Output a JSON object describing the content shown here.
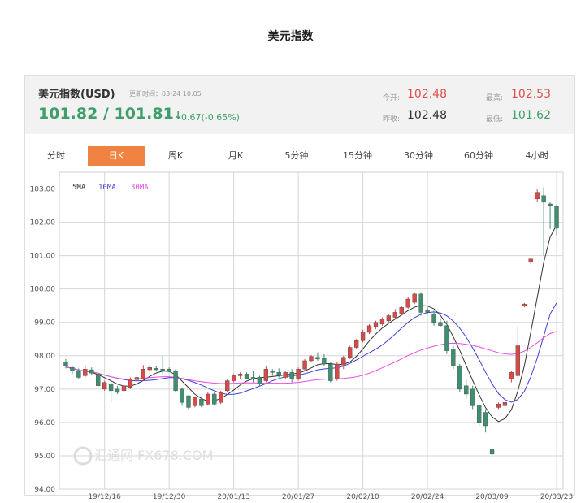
{
  "page_title": "美元指数",
  "quote": {
    "name": "美元指数(USD)",
    "update_time": "更新时间：03-24 10:05",
    "price": "101.82 / 101.81",
    "arrow": "↓",
    "change": "-0.67(-0.65%)",
    "open_label": "今开:",
    "open_value": "102.48",
    "high_label": "最高:",
    "high_value": "102.53",
    "prev_close_label": "昨收:",
    "prev_close_value": "102.48",
    "low_label": "最低:",
    "low_value": "101.62"
  },
  "tabs": [
    {
      "label": "分时",
      "active": false
    },
    {
      "label": "日K",
      "active": true
    },
    {
      "label": "周K",
      "active": false
    },
    {
      "label": "月K",
      "active": false
    },
    {
      "label": "5分钟",
      "active": false
    },
    {
      "label": "15分钟",
      "active": false
    },
    {
      "label": "30分钟",
      "active": false
    },
    {
      "label": "60分钟",
      "active": false
    },
    {
      "label": "4小时",
      "active": false
    }
  ],
  "watermark": "汇通网 FX678.COM",
  "colors": {
    "up": "#d64a4a",
    "down": "#3f8f6e",
    "price_green": "#3f9f6a",
    "accent_red": "#e0524c",
    "tab_active": "#f08341",
    "ma5": "#333333",
    "ma10": "#3f40d6",
    "ma30": "#e64fe3"
  },
  "chart_data": {
    "type": "candlestick",
    "title": "",
    "xlabel": "",
    "ylabel": "",
    "ylim": [
      94.0,
      103.5
    ],
    "yticks": [
      "94.00",
      "95.00",
      "96.00",
      "97.00",
      "98.00",
      "99.00",
      "100.00",
      "101.00",
      "102.00",
      "103.00"
    ],
    "xtick_labels": [
      "19/12/16",
      "19/12/30",
      "20/01/13",
      "20/01/27",
      "20/02/10",
      "20/02/24",
      "20/03/09",
      "20/03/23"
    ],
    "grid": true,
    "legend": [
      "5MA",
      "10MA",
      "30MA"
    ],
    "legend_position": "top-left",
    "candles": [
      {
        "o": 97.82,
        "h": 97.9,
        "l": 97.62,
        "c": 97.7
      },
      {
        "o": 97.65,
        "h": 97.7,
        "l": 97.45,
        "c": 97.55
      },
      {
        "o": 97.55,
        "h": 97.62,
        "l": 97.3,
        "c": 97.35
      },
      {
        "o": 97.4,
        "h": 97.7,
        "l": 97.35,
        "c": 97.6
      },
      {
        "o": 97.58,
        "h": 97.65,
        "l": 97.42,
        "c": 97.48
      },
      {
        "o": 97.45,
        "h": 97.5,
        "l": 97.05,
        "c": 97.1
      },
      {
        "o": 97.0,
        "h": 97.25,
        "l": 96.95,
        "c": 97.2
      },
      {
        "o": 97.15,
        "h": 97.25,
        "l": 96.6,
        "c": 96.95
      },
      {
        "o": 97.0,
        "h": 97.1,
        "l": 96.85,
        "c": 96.9
      },
      {
        "o": 96.95,
        "h": 97.15,
        "l": 96.9,
        "c": 97.1
      },
      {
        "o": 97.05,
        "h": 97.35,
        "l": 97.0,
        "c": 97.3
      },
      {
        "o": 97.28,
        "h": 97.42,
        "l": 97.2,
        "c": 97.35
      },
      {
        "o": 97.3,
        "h": 97.72,
        "l": 97.25,
        "c": 97.6
      },
      {
        "o": 97.58,
        "h": 97.75,
        "l": 97.5,
        "c": 97.65
      },
      {
        "o": 97.62,
        "h": 97.7,
        "l": 97.55,
        "c": 97.58
      },
      {
        "o": 97.6,
        "h": 98.0,
        "l": 97.45,
        "c": 97.55
      },
      {
        "o": 97.6,
        "h": 97.65,
        "l": 97.5,
        "c": 97.55
      },
      {
        "o": 97.55,
        "h": 97.6,
        "l": 96.9,
        "c": 96.95
      },
      {
        "o": 97.0,
        "h": 97.05,
        "l": 96.5,
        "c": 96.6
      },
      {
        "o": 96.8,
        "h": 96.82,
        "l": 96.4,
        "c": 96.45
      },
      {
        "o": 96.5,
        "h": 96.78,
        "l": 96.45,
        "c": 96.75
      },
      {
        "o": 96.7,
        "h": 96.75,
        "l": 96.45,
        "c": 96.5
      },
      {
        "o": 96.55,
        "h": 96.9,
        "l": 96.5,
        "c": 96.85
      },
      {
        "o": 96.85,
        "h": 96.9,
        "l": 96.5,
        "c": 96.55
      },
      {
        "o": 96.6,
        "h": 96.95,
        "l": 96.55,
        "c": 96.9
      },
      {
        "o": 96.95,
        "h": 97.3,
        "l": 96.9,
        "c": 97.25
      },
      {
        "o": 97.25,
        "h": 97.45,
        "l": 97.2,
        "c": 97.4
      },
      {
        "o": 97.4,
        "h": 97.5,
        "l": 97.3,
        "c": 97.45
      },
      {
        "o": 97.45,
        "h": 97.5,
        "l": 97.3,
        "c": 97.32
      },
      {
        "o": 97.35,
        "h": 97.55,
        "l": 97.2,
        "c": 97.3
      },
      {
        "o": 97.35,
        "h": 97.4,
        "l": 97.1,
        "c": 97.15
      },
      {
        "o": 97.25,
        "h": 97.7,
        "l": 97.2,
        "c": 97.6
      },
      {
        "o": 97.55,
        "h": 97.6,
        "l": 97.4,
        "c": 97.5
      },
      {
        "o": 97.5,
        "h": 97.62,
        "l": 97.35,
        "c": 97.4
      },
      {
        "o": 97.35,
        "h": 97.55,
        "l": 97.3,
        "c": 97.5
      },
      {
        "o": 97.5,
        "h": 97.6,
        "l": 97.2,
        "c": 97.3
      },
      {
        "o": 97.3,
        "h": 97.65,
        "l": 97.25,
        "c": 97.6
      },
      {
        "o": 97.6,
        "h": 97.9,
        "l": 97.55,
        "c": 97.85
      },
      {
        "o": 97.85,
        "h": 98.02,
        "l": 97.8,
        "c": 97.98
      },
      {
        "o": 97.95,
        "h": 98.1,
        "l": 97.85,
        "c": 97.9
      },
      {
        "o": 97.92,
        "h": 98.05,
        "l": 97.7,
        "c": 97.75
      },
      {
        "o": 97.75,
        "h": 97.8,
        "l": 97.2,
        "c": 97.25
      },
      {
        "o": 97.3,
        "h": 97.82,
        "l": 97.25,
        "c": 97.75
      },
      {
        "o": 97.72,
        "h": 98.0,
        "l": 97.6,
        "c": 97.95
      },
      {
        "o": 97.95,
        "h": 98.3,
        "l": 97.9,
        "c": 98.25
      },
      {
        "o": 98.25,
        "h": 98.5,
        "l": 98.2,
        "c": 98.45
      },
      {
        "o": 98.45,
        "h": 98.78,
        "l": 98.4,
        "c": 98.72
      },
      {
        "o": 98.7,
        "h": 98.95,
        "l": 98.65,
        "c": 98.9
      },
      {
        "o": 98.88,
        "h": 99.05,
        "l": 98.8,
        "c": 99.0
      },
      {
        "o": 98.95,
        "h": 99.15,
        "l": 98.9,
        "c": 99.1
      },
      {
        "o": 99.05,
        "h": 99.25,
        "l": 99.0,
        "c": 99.2
      },
      {
        "o": 99.15,
        "h": 99.4,
        "l": 99.1,
        "c": 99.3
      },
      {
        "o": 99.25,
        "h": 99.5,
        "l": 99.2,
        "c": 99.45
      },
      {
        "o": 99.45,
        "h": 99.75,
        "l": 99.4,
        "c": 99.7
      },
      {
        "o": 99.6,
        "h": 99.9,
        "l": 99.55,
        "c": 99.85
      },
      {
        "o": 99.85,
        "h": 99.9,
        "l": 99.2,
        "c": 99.3
      },
      {
        "o": 99.35,
        "h": 99.45,
        "l": 99.25,
        "c": 99.3
      },
      {
        "o": 99.25,
        "h": 99.35,
        "l": 98.9,
        "c": 99.0
      },
      {
        "o": 99.0,
        "h": 99.1,
        "l": 98.85,
        "c": 98.9
      },
      {
        "o": 98.9,
        "h": 99.05,
        "l": 98.05,
        "c": 98.15
      },
      {
        "o": 98.2,
        "h": 98.3,
        "l": 97.6,
        "c": 97.7
      },
      {
        "o": 97.7,
        "h": 97.75,
        "l": 96.9,
        "c": 97.0
      },
      {
        "o": 97.1,
        "h": 97.3,
        "l": 96.7,
        "c": 96.85
      },
      {
        "o": 97.0,
        "h": 97.1,
        "l": 96.4,
        "c": 96.5
      },
      {
        "o": 96.5,
        "h": 96.6,
        "l": 95.9,
        "c": 96.0
      },
      {
        "o": 96.3,
        "h": 96.4,
        "l": 95.7,
        "c": 95.9
      },
      {
        "o": 95.2,
        "h": 95.25,
        "l": 95.0,
        "c": 95.05
      },
      {
        "o": 96.45,
        "h": 96.6,
        "l": 96.4,
        "c": 96.55
      },
      {
        "o": 96.5,
        "h": 96.65,
        "l": 96.45,
        "c": 96.6
      },
      {
        "o": 97.3,
        "h": 97.55,
        "l": 97.2,
        "c": 97.5
      },
      {
        "o": 97.4,
        "h": 98.85,
        "l": 97.3,
        "c": 98.3
      },
      {
        "o": 99.5,
        "h": 99.58,
        "l": 99.45,
        "c": 99.55
      },
      {
        "o": 100.8,
        "h": 100.95,
        "l": 100.75,
        "c": 100.9
      },
      {
        "o": 102.7,
        "h": 103.0,
        "l": 102.6,
        "c": 102.9
      },
      {
        "o": 102.8,
        "h": 103.05,
        "l": 101.0,
        "c": 102.6
      },
      {
        "o": 102.55,
        "h": 102.6,
        "l": 101.8,
        "c": 102.5
      },
      {
        "o": 102.48,
        "h": 102.53,
        "l": 101.62,
        "c": 101.82
      }
    ]
  }
}
